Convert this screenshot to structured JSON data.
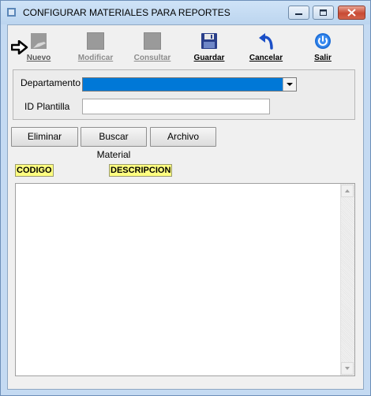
{
  "window": {
    "title": "CONFIGURAR MATERIALES PARA REPORTES"
  },
  "toolbar": {
    "nuevo": {
      "label": "Nuevo",
      "icon": "new-document-icon",
      "enabled": true
    },
    "modificar": {
      "label": "Modificar",
      "icon": "edit-icon",
      "enabled": false
    },
    "consultar": {
      "label": "Consultar",
      "icon": "query-icon",
      "enabled": false
    },
    "guardar": {
      "label": "Guardar",
      "icon": "floppy-disk-icon",
      "enabled": true
    },
    "cancelar": {
      "label": "Cancelar",
      "icon": "undo-arrow-icon",
      "enabled": true
    },
    "salir": {
      "label": "Salir",
      "icon": "power-icon",
      "enabled": true
    }
  },
  "form": {
    "departamento_label": "Departamento",
    "departamento_value": "",
    "id_plantilla_label": "ID Plantilla",
    "id_plantilla_value": ""
  },
  "actions": {
    "eliminar": "Eliminar",
    "buscar_material": "Buscar Material",
    "archivo": "Archivo"
  },
  "list": {
    "columns": [
      "CODIGO",
      "DESCRIPCION"
    ],
    "rows": []
  },
  "colors": {
    "title_bar": "#c4daf2",
    "selection": "#0078d7",
    "column_header": "#ffff80",
    "close_button": "#c84a34"
  }
}
